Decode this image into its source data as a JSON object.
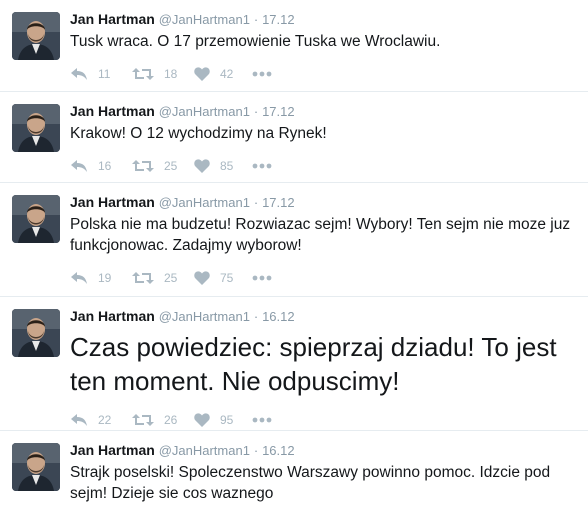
{
  "tweets": [
    {
      "name": "Jan Hartman",
      "handle": "@JanHartman1",
      "sep": "·",
      "time": "17.12",
      "text": "Tusk wraca. O 17 przemowienie Tuska we Wroclawiu.",
      "replies": "11",
      "retweets": "18",
      "likes": "42",
      "large": false
    },
    {
      "name": "Jan Hartman",
      "handle": "@JanHartman1",
      "sep": "·",
      "time": "17.12",
      "text": "Krakow! O 12 wychodzimy na Rynek!",
      "replies": "16",
      "retweets": "25",
      "likes": "85",
      "large": false
    },
    {
      "name": "Jan Hartman",
      "handle": "@JanHartman1",
      "sep": "·",
      "time": "17.12",
      "text": "Polska nie ma budzetu! Rozwiazac sejm! Wybory! Ten sejm nie moze juz funkcjonowac. Zadajmy wyborow!",
      "replies": "19",
      "retweets": "25",
      "likes": "75",
      "large": false
    },
    {
      "name": "Jan Hartman",
      "handle": "@JanHartman1",
      "sep": "·",
      "time": "16.12",
      "text": "Czas powiedziec: spieprzaj dziadu! To jest ten moment. Nie odpuscimy!",
      "replies": "22",
      "retweets": "26",
      "likes": "95",
      "large": true
    },
    {
      "name": "Jan Hartman",
      "handle": "@JanHartman1",
      "sep": "·",
      "time": "16.12",
      "text": "Strajk poselski! Spoleczenstwo Warszawy powinno pomoc. Idzcie pod sejm! Dzieje sie cos waznego",
      "replies": "",
      "retweets": "",
      "likes": "",
      "large": false
    }
  ],
  "icons": {
    "reply": "reply-icon",
    "retweet": "retweet-icon",
    "like": "heart-icon",
    "more": "more-icon"
  },
  "colors": {
    "action_gray": "#aab8c2",
    "meta_gray": "#8899a6",
    "divider": "#e6ecf0"
  }
}
